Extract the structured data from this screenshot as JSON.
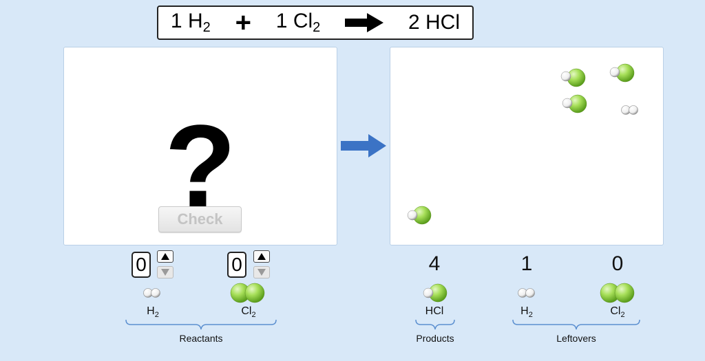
{
  "equation": {
    "h2_coef": "1",
    "h2_formula": "H",
    "h2_sub": "2",
    "plus": "+",
    "cl2_coef": "1",
    "cl2_formula": "Cl",
    "cl2_sub": "2",
    "hcl_coef": "2",
    "hcl_formula": "HCl"
  },
  "before": {
    "question": "?",
    "check_label": "Check"
  },
  "reactants": {
    "group_label": "Reactants",
    "items": [
      {
        "value": "0",
        "formula": "H",
        "sub": "2"
      },
      {
        "value": "0",
        "formula": "Cl",
        "sub": "2"
      }
    ]
  },
  "results": {
    "products_label": "Products",
    "leftovers_label": "Leftovers",
    "items": [
      {
        "count": "4",
        "formula": "HCl",
        "sub": ""
      },
      {
        "count": "1",
        "formula": "H",
        "sub": "2"
      },
      {
        "count": "0",
        "formula": "Cl",
        "sub": "2"
      }
    ]
  },
  "colors": {
    "background": "#d8e8f8",
    "chlorine": "#8fd63a",
    "hydrogen": "#ffffff",
    "arrow": "#3b73c5",
    "brace": "#5b8fd0"
  },
  "icons": {
    "flow_arrow": "right-arrow-icon",
    "spinner_up": "up-triangle-icon",
    "spinner_down": "down-triangle-icon"
  }
}
